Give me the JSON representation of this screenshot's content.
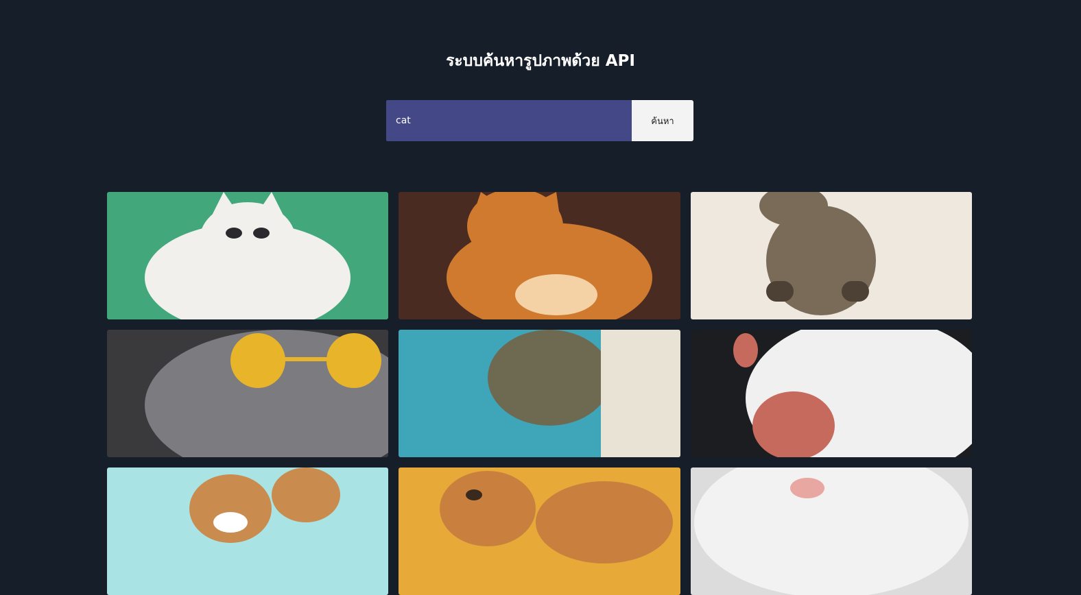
{
  "page": {
    "title": "ระบบค้นหารูปภาพด้วย API"
  },
  "search": {
    "value": "cat",
    "button_label": "ค้นหา"
  },
  "results": [
    {
      "name": "cat-photo-1",
      "bg": "#43a77c",
      "fur": "#f2f0ec",
      "accent": "#2a2a2e"
    },
    {
      "name": "cat-photo-2",
      "bg": "#4a2b22",
      "fur": "#cf7a2e",
      "accent": "#f5d2a6"
    },
    {
      "name": "cat-photo-3",
      "bg": "#eee8df",
      "fur": "#7a6a58",
      "accent": "#4d4034"
    },
    {
      "name": "cat-photo-4",
      "bg": "#3a3a3d",
      "fur": "#7b7b80",
      "accent": "#e8b52a"
    },
    {
      "name": "cat-photo-5",
      "bg": "#3ea6b8",
      "fur": "#6e6a52",
      "accent": "#e9e3d6"
    },
    {
      "name": "cat-photo-6",
      "bg": "#1b1d20",
      "fur": "#f0f0f0",
      "accent": "#c76a5e"
    },
    {
      "name": "cat-photo-7",
      "bg": "#a9e3e3",
      "fur": "#c98b4e",
      "accent": "#ffffff"
    },
    {
      "name": "cat-photo-8",
      "bg": "#e7aa38",
      "fur": "#c9803f",
      "accent": "#3a2a1e"
    },
    {
      "name": "cat-photo-9",
      "bg": "#dcdcdc",
      "fur": "#f2f2f2",
      "accent": "#e9a7a2"
    }
  ]
}
